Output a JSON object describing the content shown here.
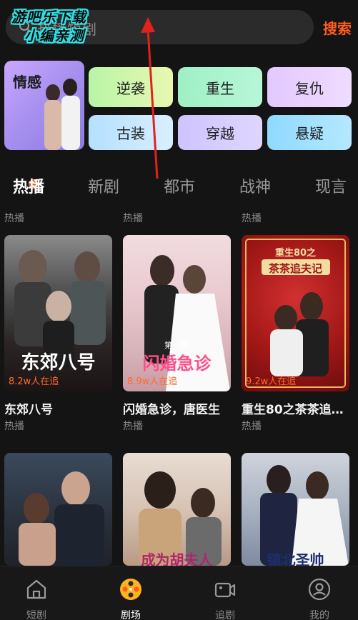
{
  "header": {
    "search_placeholder": "热播短剧",
    "search_button": "搜索",
    "watermark_line1": "游吧乐下载",
    "watermark_line2": "小编亲测"
  },
  "categories": {
    "featured": "情感",
    "items": [
      "逆袭",
      "重生",
      "复仇",
      "古装",
      "穿越",
      "悬疑"
    ]
  },
  "tabs": [
    "热播",
    "新剧",
    "都市",
    "战神",
    "现言"
  ],
  "section_labels": [
    "热播",
    "热播",
    "热播"
  ],
  "cards": [
    {
      "title": "东郊八号",
      "sub": "热播",
      "watch": "8.2w人在追",
      "poster_text": "东郊八号"
    },
    {
      "title": "闪婚急诊，唐医生",
      "sub": "热播",
      "watch": "8.9w人在追",
      "poster_text": "闪婚急诊",
      "episode": "第一集"
    },
    {
      "title": "重生80之茶茶追…",
      "sub": "热播",
      "watch": "9.2w人在追",
      "poster_text": "茶茶追夫记",
      "poster_top": "重生80之"
    }
  ],
  "row2_posters": [
    "成为胡夫人",
    "镇北圣帅"
  ],
  "nav": [
    "短剧",
    "剧场",
    "追剧",
    "我的"
  ],
  "colors": {
    "accent": "#ff5a1f",
    "background": "#141414"
  }
}
